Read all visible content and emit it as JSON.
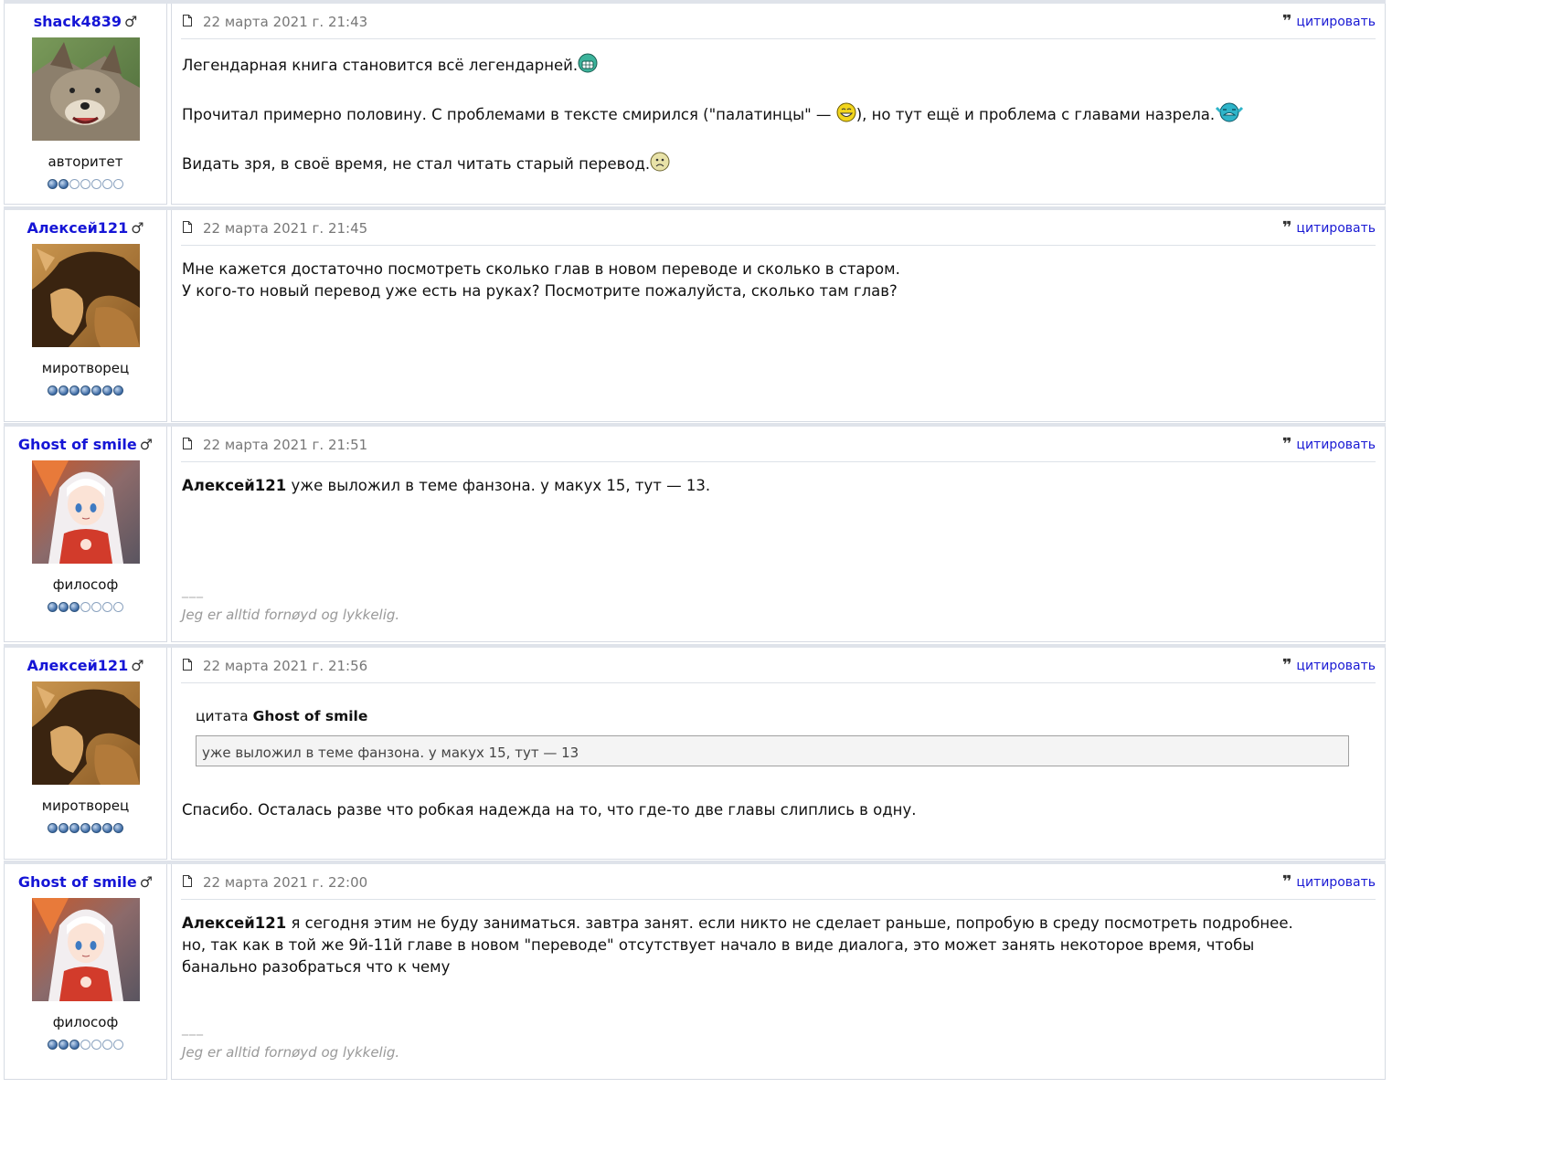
{
  "quote_label": "цитировать",
  "posts": [
    {
      "username": "shack4839",
      "gender": "♂",
      "rank": "авторитет",
      "rank_level": 2,
      "date": "22 марта 2021 г. 21:43",
      "paragraphs": [
        "Легендарная книга становится всё легендарней.",
        "Прочитал примерно половину. С проблемами в тексте смирился (\"палатинцы\" — ",
        "), но тут ещё и проблема с главами назрела.",
        "Видать зря, в своё время, не стал читать старый перевод."
      ]
    },
    {
      "username": "Алексей121",
      "gender": "♂",
      "rank": "миротворец",
      "rank_level": 7,
      "date": "22 марта 2021 г. 21:45",
      "lines": [
        "Мне кажется достаточно посмотреть сколько глав в новом переводе и сколько в старом.",
        "У кого-то новый перевод уже есть на руках? Посмотрите пожалуйста, сколько там глав?"
      ]
    },
    {
      "username": "Ghost of smile",
      "gender": "♂",
      "rank": "философ",
      "rank_level": 3,
      "date": "22 марта 2021 г. 21:51",
      "mention": "Алексей121",
      "text": " уже выложил в теме фанзона. у макух 15, тут — 13.",
      "sig_sep": "___",
      "signature": "Jeg er alltid fornøyd og lykkelig."
    },
    {
      "username": "Алексей121",
      "gender": "♂",
      "rank": "миротворец",
      "rank_level": 7,
      "date": "22 марта 2021 г. 21:56",
      "quote_prefix": "цитата",
      "quote_author": "Ghost of smile",
      "quote_text": "уже выложил в теме фанзона. у макух 15, тут — 13",
      "text": "Спасибо. Осталась разве что робкая надежда на то, что где-то две главы слиплись в одну."
    },
    {
      "username": "Ghost of smile",
      "gender": "♂",
      "rank": "философ",
      "rank_level": 3,
      "date": "22 марта 2021 г. 22:00",
      "mention": "Алексей121",
      "text_line1": " я сегодня этим не буду заниматься. завтра занят. если никто не сделает раньше, попробую в среду посмотреть подробнее.",
      "text_line2": "но, так как в той же 9й-11й главе в новом \"переводе\" отсутствует начало в виде диалога, это может занять некоторое время, чтобы",
      "text_line3": "банально разобраться что к чему",
      "sig_sep": "___",
      "signature": "Jeg er alltid fornøyd og lykkelig."
    }
  ]
}
